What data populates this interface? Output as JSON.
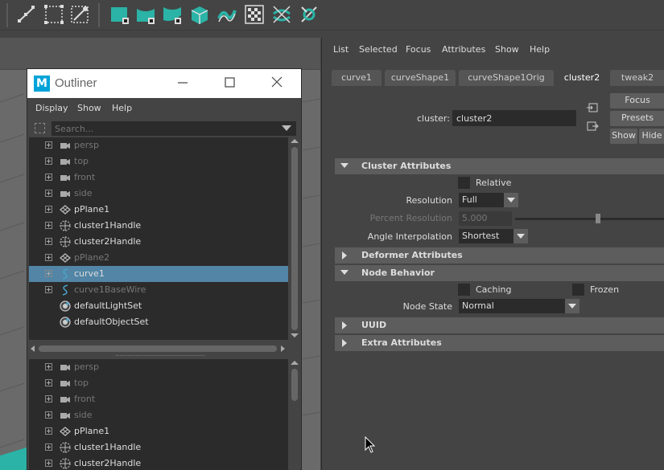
{
  "shelf": {
    "icons": [
      "ep-curve-tool-icon",
      "lattice-icon",
      "cluster-icon",
      "plane-icon",
      "bend-icon",
      "twist-icon",
      "box-icon",
      "wire-icon",
      "checker-icon",
      "wrap-icon",
      "sculpt-icon"
    ]
  },
  "outliner": {
    "title": "Outliner",
    "logo": "M",
    "menus": [
      "Display",
      "Show",
      "Help"
    ],
    "search_placeholder": "Search...",
    "items": [
      {
        "label": "persp",
        "icon": "camera-icon",
        "dim": true,
        "selected": false,
        "expand": true
      },
      {
        "label": "top",
        "icon": "camera-icon",
        "dim": true,
        "selected": false,
        "expand": true
      },
      {
        "label": "front",
        "icon": "camera-icon",
        "dim": true,
        "selected": false,
        "expand": true
      },
      {
        "label": "side",
        "icon": "camera-icon",
        "dim": true,
        "selected": false,
        "expand": true
      },
      {
        "label": "pPlane1",
        "icon": "mesh-icon",
        "dim": false,
        "selected": false,
        "expand": true
      },
      {
        "label": "cluster1Handle",
        "icon": "cluster-handle-icon",
        "dim": false,
        "selected": false,
        "expand": true
      },
      {
        "label": "cluster2Handle",
        "icon": "cluster-handle-icon",
        "dim": false,
        "selected": false,
        "expand": true
      },
      {
        "label": "pPlane2",
        "icon": "mesh-icon",
        "dim": true,
        "selected": false,
        "expand": true
      },
      {
        "label": "curve1",
        "icon": "curve-icon",
        "dim": false,
        "selected": true,
        "expand": true
      },
      {
        "label": "curve1BaseWire",
        "icon": "curve-icon",
        "dim": true,
        "selected": false,
        "expand": true
      },
      {
        "label": "defaultLightSet",
        "icon": "set-icon",
        "dim": false,
        "selected": false,
        "expand": false
      },
      {
        "label": "defaultObjectSet",
        "icon": "set-icon",
        "dim": false,
        "selected": false,
        "expand": false
      }
    ],
    "items_bottom": [
      {
        "label": "persp",
        "icon": "camera-icon",
        "dim": true
      },
      {
        "label": "top",
        "icon": "camera-icon",
        "dim": true
      },
      {
        "label": "front",
        "icon": "camera-icon",
        "dim": true
      },
      {
        "label": "side",
        "icon": "camera-icon",
        "dim": true
      },
      {
        "label": "pPlane1",
        "icon": "mesh-icon",
        "dim": false
      },
      {
        "label": "cluster1Handle",
        "icon": "cluster-handle-icon",
        "dim": false
      },
      {
        "label": "cluster2Handle",
        "icon": "cluster-handle-icon",
        "dim": false
      }
    ]
  },
  "attribute_editor": {
    "menus": [
      "List",
      "Selected",
      "Focus",
      "Attributes",
      "Show",
      "Help"
    ],
    "tabs": [
      "curve1",
      "curveShape1",
      "curveShape1Orig",
      "cluster2",
      "tweak2"
    ],
    "active_tab": "cluster2",
    "node_label": "cluster:",
    "node_value": "cluster2",
    "buttons": {
      "focus": "Focus",
      "presets": "Presets",
      "show": "Show",
      "hide": "Hide"
    },
    "sections": {
      "cluster_attributes": "Cluster Attributes",
      "deformer_attributes": "Deformer Attributes",
      "node_behavior": "Node Behavior",
      "uuid": "UUID",
      "extra_attributes": "Extra Attributes"
    },
    "cluster": {
      "relative_label": "Relative",
      "resolution_label": "Resolution",
      "resolution_value": "Full",
      "percent_resolution_label": "Percent Resolution",
      "percent_resolution_value": "5.000",
      "angle_interpolation_label": "Angle Interpolation",
      "angle_interpolation_value": "Shortest"
    },
    "node_behavior": {
      "caching_label": "Caching",
      "frozen_label": "Frozen",
      "node_state_label": "Node State",
      "node_state_value": "Normal"
    }
  },
  "colors": {
    "selection": "#5285a6",
    "accent_teal": "#2ab3a6",
    "maya_blue": "#00a3d9"
  }
}
